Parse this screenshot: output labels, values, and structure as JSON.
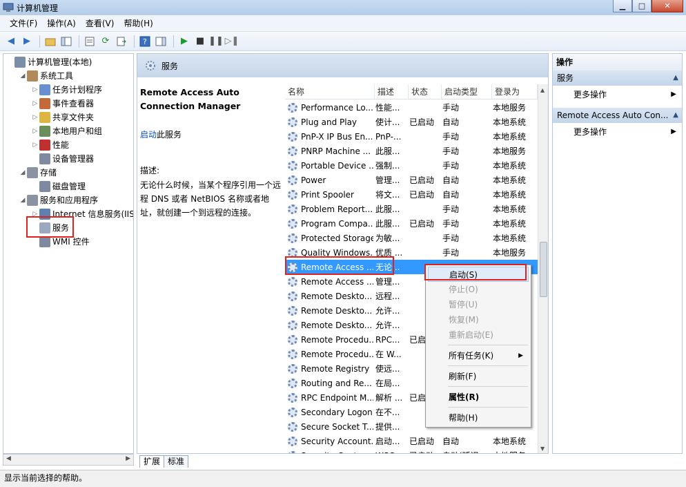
{
  "window": {
    "title": "计算机管理",
    "min": "▁",
    "max": "□",
    "close": "✕"
  },
  "menu": [
    "文件(F)",
    "操作(A)",
    "查看(V)",
    "帮助(H)"
  ],
  "tree": [
    {
      "label": "计算机管理(本地)",
      "indent": 0,
      "arrow": "",
      "color": "#7a8ea8"
    },
    {
      "label": "系统工具",
      "indent": 1,
      "arrow": "◢",
      "color": "#b08a5a"
    },
    {
      "label": "任务计划程序",
      "indent": 2,
      "arrow": "▷",
      "color": "#6a8fd0"
    },
    {
      "label": "事件查看器",
      "indent": 2,
      "arrow": "▷",
      "color": "#c46a3a"
    },
    {
      "label": "共享文件夹",
      "indent": 2,
      "arrow": "▷",
      "color": "#e0b440"
    },
    {
      "label": "本地用户和组",
      "indent": 2,
      "arrow": "▷",
      "color": "#6b8f5a"
    },
    {
      "label": "性能",
      "indent": 2,
      "arrow": "▷",
      "color": "#c03030"
    },
    {
      "label": "设备管理器",
      "indent": 2,
      "arrow": "",
      "color": "#7f8aa0"
    },
    {
      "label": "存储",
      "indent": 1,
      "arrow": "◢",
      "color": "#8b93a3"
    },
    {
      "label": "磁盘管理",
      "indent": 2,
      "arrow": "",
      "color": "#7f8aa0"
    },
    {
      "label": "服务和应用程序",
      "indent": 1,
      "arrow": "◢",
      "color": "#8b93a3"
    },
    {
      "label": "Internet 信息服务(IIS)管",
      "indent": 2,
      "arrow": "▷",
      "color": "#5f7fb0"
    },
    {
      "label": "服务",
      "indent": 2,
      "arrow": "",
      "color": "#9aa9c0"
    },
    {
      "label": "WMI 控件",
      "indent": 2,
      "arrow": "",
      "color": "#7f8aa0"
    }
  ],
  "center": {
    "header": "服务",
    "desc_title": "Remote Access Auto Connection Manager",
    "start_link": "启动",
    "start_suffix": "此服务",
    "desc_label": "描述:",
    "desc_text": "无论什么时候，当某个程序引用一个远程 DNS 或者 NetBIOS 名称或者地址，就创建一个到远程的连接。"
  },
  "columns": [
    "名称",
    "描述",
    "状态",
    "启动类型",
    "登录为"
  ],
  "rows": [
    [
      "Performance Lo...",
      "性能...",
      "",
      "手动",
      "本地服务"
    ],
    [
      "Plug and Play",
      "使计...",
      "已启动",
      "自动",
      "本地系统"
    ],
    [
      "PnP-X IP Bus En...",
      "PnP-...",
      "",
      "手动",
      "本地系统"
    ],
    [
      "PNRP Machine ...",
      "此服...",
      "",
      "手动",
      "本地服务"
    ],
    [
      "Portable Device ...",
      "强制...",
      "",
      "手动",
      "本地系统"
    ],
    [
      "Power",
      "管理...",
      "已启动",
      "自动",
      "本地系统"
    ],
    [
      "Print Spooler",
      "将文...",
      "已启动",
      "自动",
      "本地系统"
    ],
    [
      "Problem Report...",
      "此服...",
      "",
      "手动",
      "本地系统"
    ],
    [
      "Program Compa...",
      "此服...",
      "已启动",
      "手动",
      "本地系统"
    ],
    [
      "Protected Storage",
      "为敏...",
      "",
      "手动",
      "本地系统"
    ],
    [
      "Quality Windows...",
      "优质 ...",
      "",
      "手动",
      "本地服务"
    ],
    [
      "Remote Access ...",
      "无论...",
      "",
      "",
      ""
    ],
    [
      "Remote Access ...",
      "管理...",
      "",
      "",
      ""
    ],
    [
      "Remote Deskto...",
      "远程...",
      "",
      "",
      ""
    ],
    [
      "Remote Deskto...",
      "允许...",
      "",
      "",
      ""
    ],
    [
      "Remote Deskto...",
      "允许...",
      "",
      "",
      ""
    ],
    [
      "Remote Procedu...",
      "RPC...",
      "已启",
      "",
      ""
    ],
    [
      "Remote Procedu...",
      "在 W...",
      "",
      "",
      ""
    ],
    [
      "Remote Registry",
      "使远...",
      "",
      "",
      ""
    ],
    [
      "Routing and Re...",
      "在局...",
      "",
      "",
      ""
    ],
    [
      "RPC Endpoint M...",
      "解析 ...",
      "已启",
      "",
      ""
    ],
    [
      "Secondary Logon",
      "在不...",
      "",
      "",
      ""
    ],
    [
      "Secure Socket T...",
      "提供...",
      "",
      "",
      ""
    ],
    [
      "Security Account...",
      "启动...",
      "已启动",
      "自动",
      "本地系统"
    ],
    [
      "Security Center",
      "WSC...",
      "已启动",
      "自动(延迟...",
      "本地服务"
    ]
  ],
  "selected_row": 11,
  "context_menu": [
    "启动(S)",
    "停止(O)",
    "暂停(U)",
    "恢复(M)",
    "重新启动(E)",
    "所有任务(K)",
    "刷新(F)",
    "属性(R)",
    "帮助(H)"
  ],
  "tabs": [
    "扩展",
    "标准"
  ],
  "actions": {
    "title": "操作",
    "section1": "服务",
    "more1": "更多操作",
    "section2": "Remote Access Auto Con...",
    "more2": "更多操作"
  },
  "status": "显示当前选择的帮助。",
  "colors": {
    "selection": "#3399ff",
    "highlight_box": "#e0211c",
    "link": "#0b4eb8"
  }
}
